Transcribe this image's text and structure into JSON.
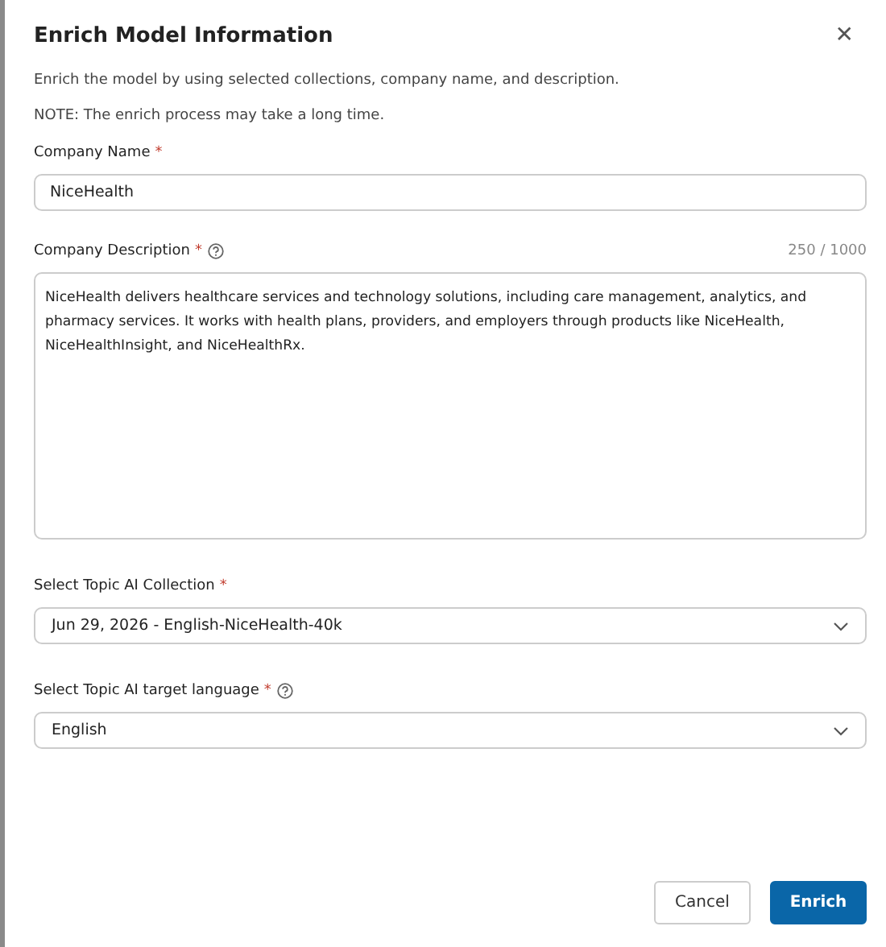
{
  "dialog": {
    "title": "Enrich Model Information",
    "close_glyph": "✕"
  },
  "intro": [
    "Enrich the model by using selected collections, company name, and description.",
    "NOTE: The enrich process may take a long time."
  ],
  "fields": [
    {
      "kind": "text",
      "label": "Company Name",
      "required_mark": "*",
      "help": false,
      "value": "NiceHealth"
    },
    {
      "kind": "textarea",
      "label": "Company Description",
      "required_mark": "*",
      "help": true,
      "counter": "250 / 1000",
      "value": "NiceHealth delivers healthcare services and technology solutions, including care management, analytics, and pharmacy services. It works with health plans, providers, and employers through products like NiceHealth, NiceHealthInsight, and NiceHealthRx."
    },
    {
      "kind": "select",
      "label": "Select Topic AI Collection",
      "required_mark": "*",
      "help": false,
      "value": "Jun 29, 2026 - English-NiceHealth-40k"
    },
    {
      "kind": "select",
      "label": "Select Topic AI target language",
      "required_mark": "*",
      "help": true,
      "value": "English"
    }
  ],
  "buttons": [
    {
      "label": "Cancel",
      "kind": "secondary"
    },
    {
      "label": "Enrich",
      "kind": "primary"
    }
  ]
}
